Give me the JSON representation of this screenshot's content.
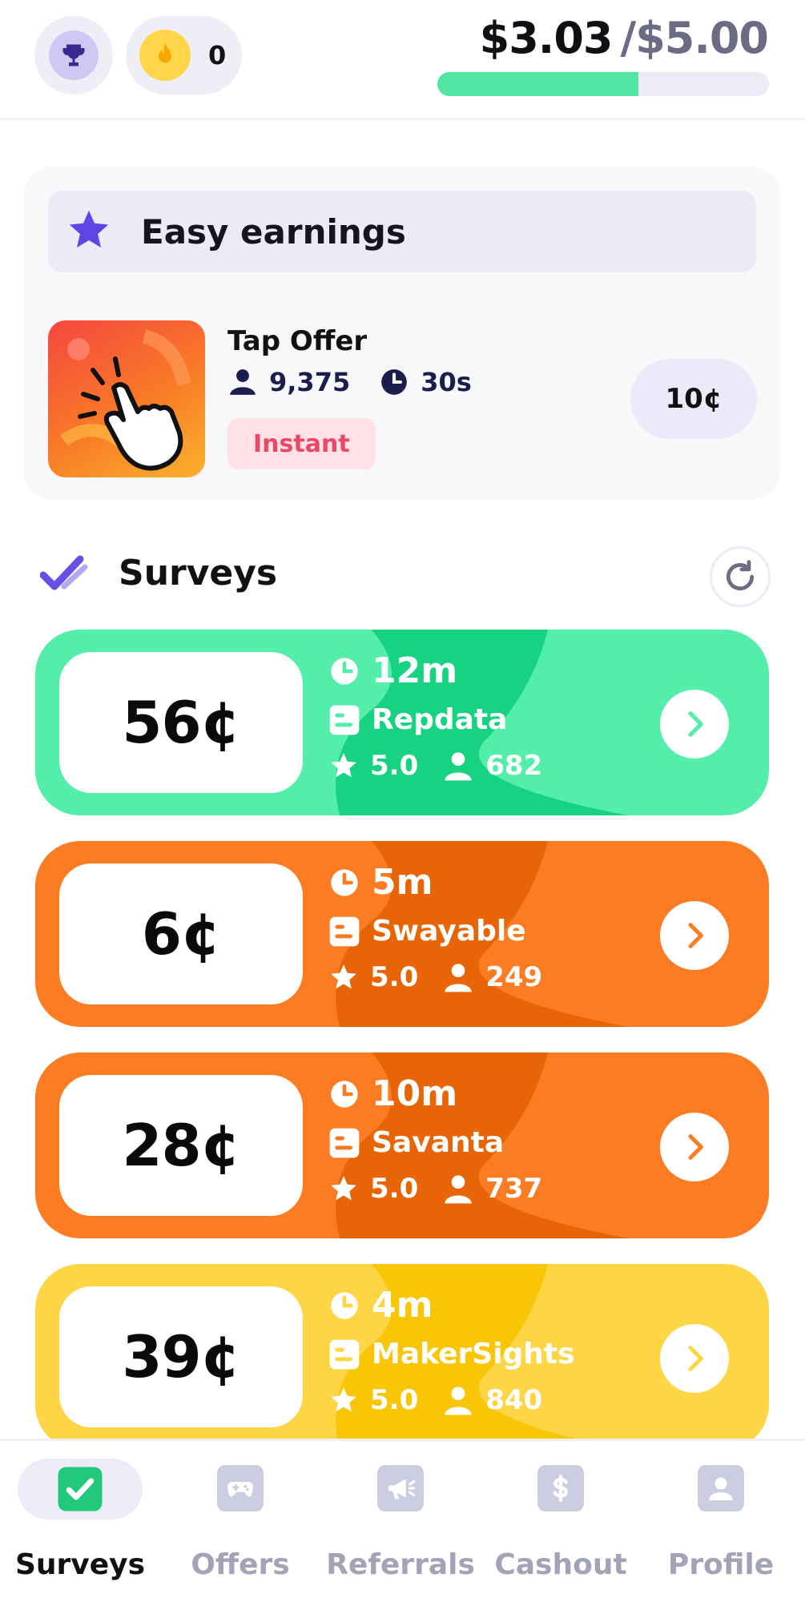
{
  "header": {
    "streak_count": "0",
    "balance_current": "$3.03",
    "balance_goal": "/$5.00",
    "progress_fraction": 0.606,
    "colors": {
      "progress_fill": "#52e6a3",
      "progress_track": "#ececf6"
    }
  },
  "easy_earnings": {
    "title": "Easy earnings",
    "offer": {
      "name": "Tap Offer",
      "users": "9,375",
      "duration": "30s",
      "tag": "Instant",
      "reward": "10¢"
    }
  },
  "surveys": {
    "title": "Surveys",
    "items": [
      {
        "reward": "56¢",
        "time": "12m",
        "provider": "Repdata",
        "rating": "5.0",
        "respondents": "682",
        "color": "#52eeaa"
      },
      {
        "reward": "6¢",
        "time": "5m",
        "provider": "Swayable",
        "rating": "5.0",
        "respondents": "249",
        "color": "#fb7c22"
      },
      {
        "reward": "28¢",
        "time": "10m",
        "provider": "Savanta",
        "rating": "5.0",
        "respondents": "737",
        "color": "#fb7c22"
      },
      {
        "reward": "39¢",
        "time": "4m",
        "provider": "MakerSights",
        "rating": "5.0",
        "respondents": "840",
        "color": "#fed645"
      }
    ]
  },
  "nav": {
    "items": [
      {
        "label": "Surveys",
        "icon": "check-icon",
        "active": true
      },
      {
        "label": "Offers",
        "icon": "gamepad-icon",
        "active": false
      },
      {
        "label": "Referrals",
        "icon": "megaphone-icon",
        "active": false
      },
      {
        "label": "Cashout",
        "icon": "dollar-icon",
        "active": false
      },
      {
        "label": "Profile",
        "icon": "user-icon",
        "active": false
      }
    ]
  }
}
